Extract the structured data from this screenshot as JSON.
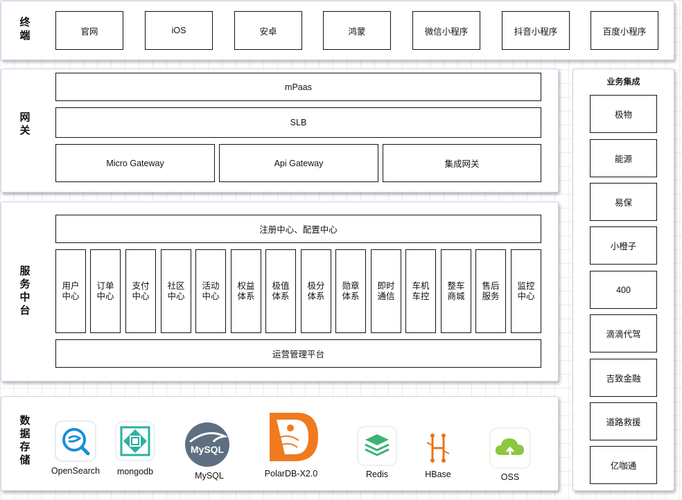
{
  "terminal": {
    "label": "终端",
    "items": [
      "官网",
      "iOS",
      "安卓",
      "鸿蒙",
      "微信小程序",
      "抖音小程序",
      "百度小程序"
    ]
  },
  "gateway": {
    "label": "网关",
    "mpaas": "mPaas",
    "slb": "SLB",
    "items": [
      "Micro Gateway",
      "Api Gateway",
      "集成网关"
    ]
  },
  "service": {
    "label": "服务中台",
    "registry": "注册中心、配置中心",
    "modules": [
      "用户中心",
      "订单中心",
      "支付中心",
      "社区中心",
      "活动中心",
      "权益体系",
      "极值体系",
      "极分体系",
      "勋章体系",
      "即时通信",
      "车机车控",
      "整车商城",
      "售后服务",
      "监控中心"
    ],
    "ops": "运营管理平台"
  },
  "storage": {
    "label": "数据存储",
    "items": [
      {
        "name": "OpenSearch",
        "icon": "opensearch-icon"
      },
      {
        "name": "mongodb",
        "icon": "mongodb-icon"
      },
      {
        "name": "MySQL",
        "icon": "mysql-icon"
      },
      {
        "name": "PolarDB-X2.0",
        "icon": "polardb-icon"
      },
      {
        "name": "Redis",
        "icon": "redis-icon"
      },
      {
        "name": "HBase",
        "icon": "hbase-icon"
      },
      {
        "name": "OSS",
        "icon": "oss-icon"
      }
    ],
    "mysql_logo_text": "MySQL"
  },
  "integration": {
    "title": "业务集成",
    "items": [
      "极物",
      "能源",
      "易保",
      "小橙子",
      "400",
      "滴滴代驾",
      "吉致金融",
      "道路救援",
      "亿咖通"
    ]
  },
  "colors": {
    "panel_border": "#c5d3e8",
    "opensearch": "#1a8fd6",
    "mongodb": "#2ab0a0",
    "mysql": "#5d6f80",
    "polardb": "#f07a1e",
    "redis": "#3cb371",
    "hbase": "#e8741a",
    "oss": "#8dc63f"
  }
}
